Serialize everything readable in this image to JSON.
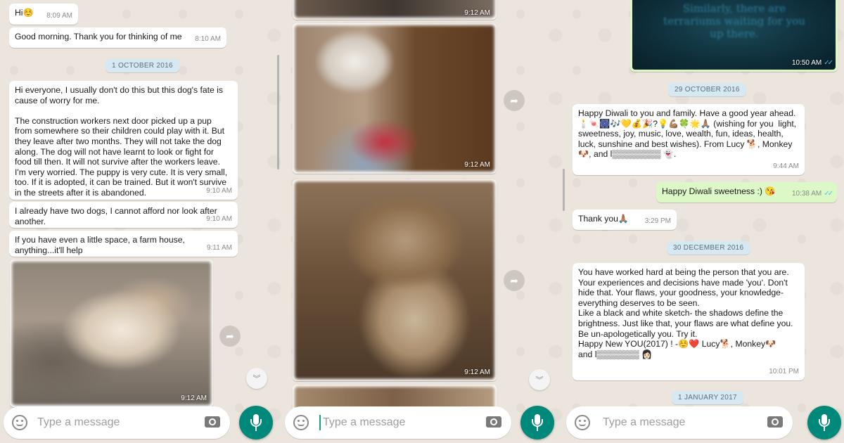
{
  "panel1": {
    "msg_hi": {
      "text": "Hi☺️",
      "time": "8:09 AM"
    },
    "msg_morning": {
      "text": "Good morning. Thank you for thinking of me",
      "time": "8:10 AM"
    },
    "date1": "1 OCTOBER 2016",
    "msg_long": {
      "text": "Hi everyone, I usually don't do this but this dog's fate is cause of worry for me.\n\nThe construction workers next door picked up a pup from somewhere so their children could play with it. But they leave after two months. They will not take the dog along. The dog will not have learnt to look or fight for food till then. It will not survive after the workers leave. I'm very worried. The puppy is very cute. It is very small, too. If it is adopted, it can be trained. But it won't survive in the streets after it is abandoned.",
      "time": "9:10 AM"
    },
    "msg_two_dogs": {
      "text": "I already have two dogs, I cannot afford nor look after another.",
      "time": "9:10 AM"
    },
    "msg_space": {
      "text": "If you have even a little space, a farm house, anything...it'll help",
      "time": "9:11 AM"
    },
    "photo_time": "9:12 AM",
    "placeholder": "Type a message"
  },
  "panel2": {
    "photo1_time": "9:12 AM",
    "photo2_time": "9:12 AM",
    "photo3_time": "9:12 AM",
    "placeholder": "Type a message"
  },
  "panel3": {
    "top_image": {
      "caption": "Similarly, there are terrariums waiting for you up there.",
      "time": "10:50 AM"
    },
    "date1": "29 OCTOBER 2016",
    "msg_diwali": {
      "text": "Happy Diwali to you and family. Have a good year ahead. 🕯️🍬🎆🎶💛💰🎉?💡💪🏽🍀🌟🙏🏽 (wishing for you  light, sweetness, joy, music, love, wealth, fun, ideas, health, luck, sunshine and best wishes). From Lucy 🐕, Monkey🐶, and l▒▒▒▒▒▒▒▒ 👻.",
      "time": "9:44 AM"
    },
    "msg_sweetness": {
      "text": "Happy Diwali sweetness :) 😘",
      "time": "10:38 AM"
    },
    "msg_thanks": {
      "text": "Thank you🙏🏽",
      "time": "3:29 PM"
    },
    "date2": "30 DECEMBER 2016",
    "msg_new_year": {
      "text": "You have worked hard at being the person that you are. Your experiences and decisions have made 'you'. Don't hide that. Your flaws, your goodness, your knowledge- everything deserves to be seen.\nLike a black and white sketch- the shadows define the brightness. Just like that, your flaws are what define you.\nBe un-apologetically you. Try it.\nHappy New YOU(2017) ! -☺️❤️ Lucy🐕, Monkey🐶\nand l▒▒▒▒▒▒▒ 👩🏻",
      "time": "10:01 PM"
    },
    "date3": "1 JANUARY 2017",
    "placeholder": "Type a message"
  },
  "colors": {
    "accent": "#00897b",
    "outgoing": "#dcf8c6",
    "incoming": "#ffffff",
    "date_pill": "#d6e9f3",
    "ticks": "#4fc3f7"
  },
  "icons": [
    "emoji-icon",
    "camera-icon",
    "mic-icon",
    "forward-icon",
    "scroll-down-icon",
    "double-check-icon"
  ]
}
